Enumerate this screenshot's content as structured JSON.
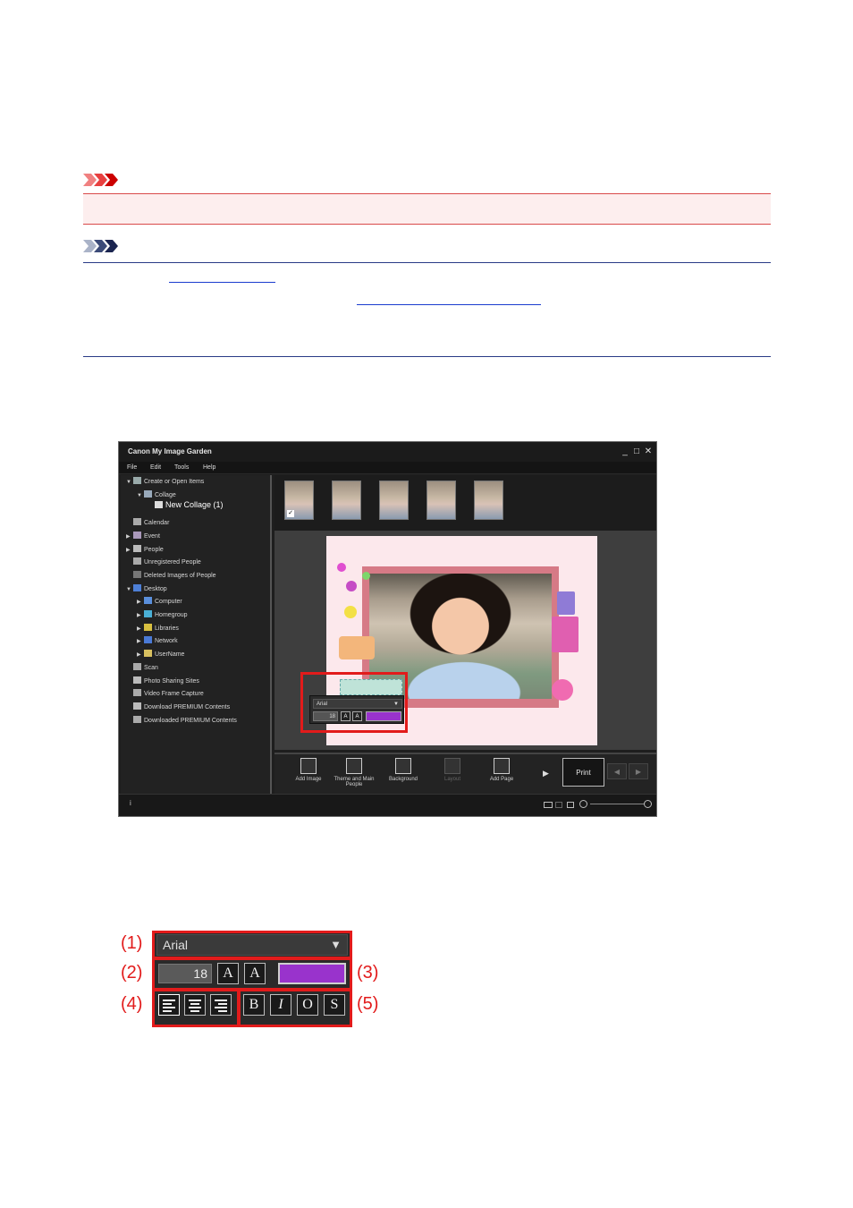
{
  "window": {
    "title": "Canon My Image Garden",
    "controls": [
      "_",
      "□",
      "✕"
    ],
    "menu": [
      "File",
      "Edit",
      "Tools",
      "Help"
    ]
  },
  "sidebar": {
    "items": [
      {
        "label": "Create or Open Items",
        "arrow": "▼",
        "level": 0
      },
      {
        "label": "Collage",
        "arrow": "▼",
        "level": 1
      },
      {
        "label": "New Collage (1)",
        "arrow": "",
        "level": 2,
        "selected": true
      },
      {
        "label": "Calendar",
        "arrow": "",
        "level": 0
      },
      {
        "label": "Event",
        "arrow": "▶",
        "level": 0
      },
      {
        "label": "People",
        "arrow": "▶",
        "level": 0
      },
      {
        "label": "Unregistered People",
        "arrow": "",
        "level": 0
      },
      {
        "label": "Deleted Images of People",
        "arrow": "",
        "level": 0
      },
      {
        "label": "Desktop",
        "arrow": "▼",
        "level": 0
      },
      {
        "label": "Computer",
        "arrow": "▶",
        "level": 1
      },
      {
        "label": "Homegroup",
        "arrow": "▶",
        "level": 1
      },
      {
        "label": "Libraries",
        "arrow": "▶",
        "level": 1
      },
      {
        "label": "Network",
        "arrow": "▶",
        "level": 1
      },
      {
        "label": "UserName",
        "arrow": "▶",
        "level": 1
      },
      {
        "label": "Scan",
        "arrow": "",
        "level": 0
      },
      {
        "label": "Photo Sharing Sites",
        "arrow": "",
        "level": 0
      },
      {
        "label": "Video Frame Capture",
        "arrow": "",
        "level": 0
      },
      {
        "label": "Download PREMIUM Contents",
        "arrow": "",
        "level": 0
      },
      {
        "label": "Downloaded PREMIUM Contents",
        "arrow": "",
        "level": 0
      }
    ]
  },
  "thumbnails": {
    "count": 5,
    "checked_index": 0,
    "check_glyph": "✓"
  },
  "mini_toolbar": {
    "font": "Arial",
    "size": "18",
    "grow_glyph": "A",
    "shrink_glyph": "A",
    "color": "#9933cc"
  },
  "tools": [
    {
      "label": "Add Image",
      "enabled": true
    },
    {
      "label": "Theme and Main People",
      "enabled": true
    },
    {
      "label": "Background",
      "enabled": true
    },
    {
      "label": "Layout",
      "enabled": false
    },
    {
      "label": "Add Page",
      "enabled": true
    }
  ],
  "print_label": "Print",
  "status": {
    "info_glyph": "i"
  },
  "enlarged_toolbar": {
    "font": "Arial",
    "font_arrow": "▼",
    "size": "18",
    "size_up_glyph": "A",
    "size_down_glyph": "A",
    "color": "#9933cc",
    "style_buttons": [
      "B",
      "I",
      "O",
      "S"
    ],
    "callouts": [
      "(1)",
      "(2)",
      "(3)",
      "(4)",
      "(5)"
    ]
  },
  "colors": {
    "important": "#d94a4a",
    "note": "#2a3b86",
    "highlight": "#e21b1b",
    "text_color_swatch": "#9933cc"
  }
}
